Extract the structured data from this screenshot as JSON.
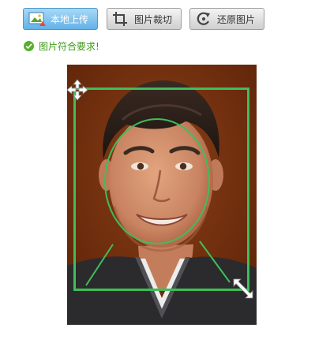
{
  "toolbar": {
    "upload_label": "本地上传",
    "crop_label": "图片裁切",
    "restore_label": "还原图片"
  },
  "status": {
    "message": "图片符合要求!"
  },
  "colors": {
    "guide_green": "#3fbe5a",
    "status_green": "#3e9a16",
    "upload_blue": "#62b2e8"
  },
  "icons": {
    "upload": "image-upload-icon",
    "crop": "crop-icon",
    "restore": "restore-icon",
    "move": "move-handle-icon",
    "resize": "resize-handle-icon",
    "status": "check-circle-icon"
  }
}
